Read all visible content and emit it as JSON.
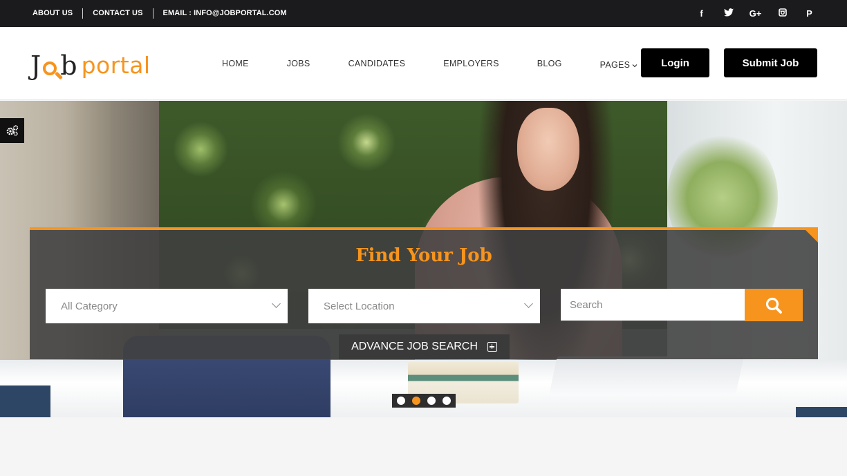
{
  "topbar": {
    "about": "ABOUT US",
    "contact": "CONTACT US",
    "email": "EMAIL : INFO@JOBPORTAL.COM",
    "social": [
      {
        "icon": "facebook-icon",
        "glyph": "f"
      },
      {
        "icon": "twitter-icon",
        "glyph": "t"
      },
      {
        "icon": "google-plus-icon",
        "glyph": "G+"
      },
      {
        "icon": "instagram-icon",
        "glyph": "◙"
      },
      {
        "icon": "pinterest-icon",
        "glyph": "P"
      }
    ]
  },
  "logo": {
    "j": "J",
    "b": "b",
    "portal": "portal"
  },
  "nav": {
    "home": "HOME",
    "jobs": "JOBS",
    "candidates": "CANDIDATES",
    "employers": "EMPLOYERS",
    "blog": "BLOG",
    "pages": "PAGES"
  },
  "buttons": {
    "login": "Login",
    "submit_job": "Submit Job"
  },
  "search_panel": {
    "title": "Find Your Job",
    "category_value": "All Category",
    "location_value": "Select Location",
    "search_placeholder": "Search",
    "advance_label": "ADVANCE JOB SEARCH"
  },
  "slider": {
    "slides": 4,
    "active_index": 1
  },
  "colors": {
    "accent": "#f7941d",
    "dark": "#1b1a1c"
  }
}
